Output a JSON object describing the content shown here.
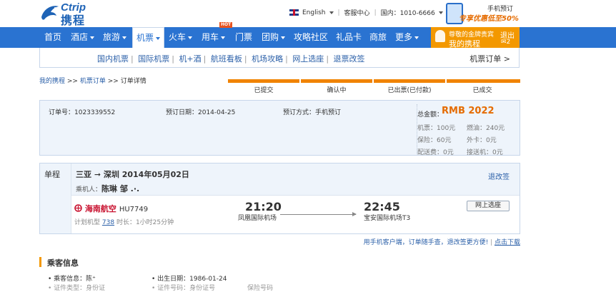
{
  "brand": {
    "word": "Ctrip",
    "cn": "携程"
  },
  "toplinks": {
    "language": "English",
    "service": "客服中心",
    "phone": "国内：1010-6666"
  },
  "mobile": {
    "line1": "手机预订",
    "line2": "专享优惠低至50%"
  },
  "nav": {
    "items": [
      {
        "label": "首页",
        "caret": false
      },
      {
        "label": "酒店",
        "caret": true
      },
      {
        "label": "旅游",
        "caret": true
      },
      {
        "label": "机票",
        "caret": true
      },
      {
        "label": "火车",
        "caret": true
      },
      {
        "label": "用车",
        "caret": true
      },
      {
        "label": "门票",
        "caret": false
      },
      {
        "label": "团购",
        "caret": true
      },
      {
        "label": "攻略社区",
        "caret": false
      },
      {
        "label": "礼品卡",
        "caret": false
      },
      {
        "label": "商旅",
        "caret": false
      },
      {
        "label": "更多",
        "caret": true
      }
    ],
    "hot_badge": "HOT",
    "user": {
      "greeting": "尊敬的金牌贵宾",
      "mytrip": "我的携程",
      "logout": "退出",
      "messages": "✉2"
    }
  },
  "subnav": {
    "links": [
      "国内机票",
      "国际机票",
      "机+酒",
      "航班看板",
      "机场攻略",
      "网上选座",
      "退票改签"
    ],
    "my_orders": "机票订单 >"
  },
  "breadcrumb": {
    "home": "我的携程",
    "orders": "机票订单",
    "current": "订单详情",
    "sep": ">>"
  },
  "steps": [
    "已提交",
    "确认中",
    "已出票(已付款)",
    "已成交"
  ],
  "order": {
    "number": "订单号：1023339552",
    "date": "预订日期：2014-04-25",
    "method": "预订方式：手机预订",
    "total_label": "总金额：",
    "total_value": "RMB 2022",
    "fees": [
      [
        "机票：100元",
        "燃油：240元"
      ],
      [
        "保险：60元",
        "外卡：0元"
      ],
      [
        "配送费：0元",
        "接送机：0元"
      ]
    ]
  },
  "flight": {
    "trip_type": "单程",
    "route": "三亚 ➞ 深圳  2014年05月02日",
    "pax_label": "乘机人：",
    "pax_name": "陈琳 邹 .·.",
    "refund": "退改签",
    "airline": "海南航空",
    "flight_no": "HU7749",
    "plane_label": "计划机型",
    "plane_model": "738",
    "duration": "时长：1小时25分钟",
    "dep_time": "21:20",
    "dep_airport": "凤凰国际机场",
    "arr_time": "22:45",
    "arr_airport": "宝安国际机场T3",
    "checkin": "网上选座"
  },
  "footer": {
    "text1": "用手机客户端，订单随手查，退改签更方便!",
    "link": "点击下载"
  },
  "passenger": {
    "title": "乘客信息",
    "name": "• 乘客信息：陈⁺",
    "birth": "• 出生日期：1986-01-24",
    "row2": [
      "• 证件类型：身份证",
      "• 证件号码：身份证号",
      "保险号码"
    ]
  }
}
